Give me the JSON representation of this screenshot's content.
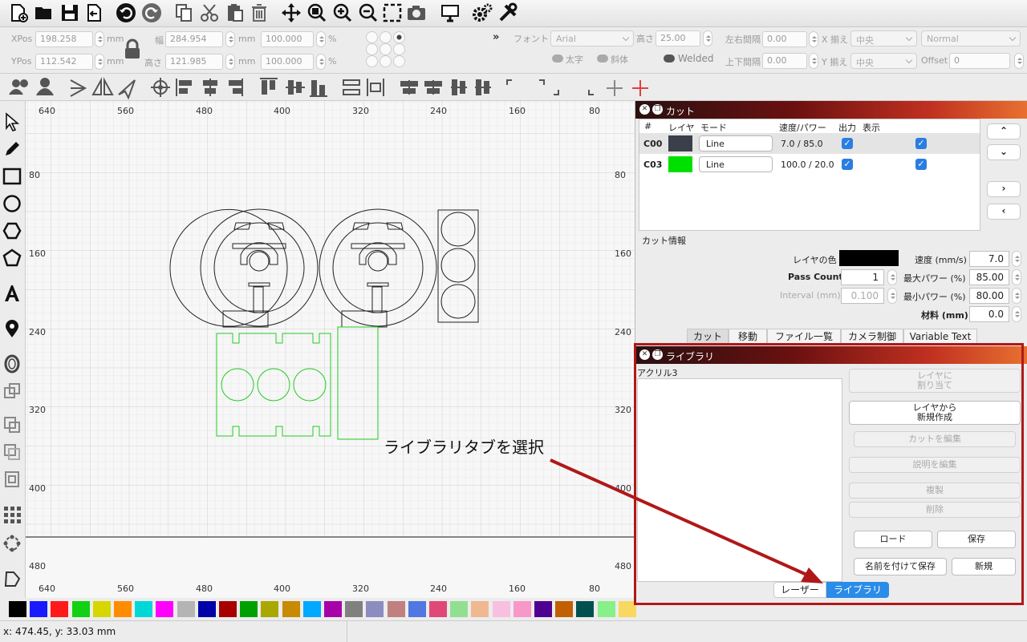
{
  "toolbar_icons": [
    "new-file-icon",
    "open-folder-icon",
    "save-icon",
    "export-icon",
    "undo-icon",
    "redo-icon",
    "copy-icon",
    "cut-icon",
    "paste-icon",
    "delete-icon",
    "move-icon",
    "zoom-fit-icon",
    "zoom-in-icon",
    "zoom-out-icon",
    "select-frame-icon",
    "camera-icon",
    "monitor-icon",
    "settings-icon",
    "tools-icon"
  ],
  "props": {
    "xpos_label": "XPos",
    "xpos": "198.258",
    "ypos_label": "YPos",
    "ypos": "112.542",
    "mm": "mm",
    "width_label": "幅",
    "width": "284.954",
    "height_label": "高さ",
    "height": "121.985",
    "scale_x": "100.000",
    "scale_y": "100.000",
    "percent": "%",
    "font_label": "フォント",
    "font": "Arial",
    "font_height_label": "高さ",
    "font_height": "25.00",
    "hspace_label": "左右間隔",
    "hspace": "0.00",
    "vspace_label": "上下間隔",
    "vspace": "0.00",
    "xalign_label": "X 揃え",
    "xalign": "中央",
    "yalign_label": "Y 揃え",
    "yalign": "中央",
    "mode": "Normal",
    "offset_label": "Offset",
    "offset": "0",
    "bold_label": "太字",
    "italic_label": "斜体",
    "welded_label": "Welded"
  },
  "ruler": {
    "top": [
      "640",
      "560",
      "480",
      "400",
      "320",
      "240",
      "160",
      "80"
    ],
    "left": [
      "80",
      "160",
      "240",
      "320",
      "400",
      "480"
    ]
  },
  "annotation": "ライブラリタブを選択",
  "palette": [
    "#000000",
    "#1a1aff",
    "#ff1a1a",
    "#12d012",
    "#d6d600",
    "#ff8c00",
    "#00d8d8",
    "#ff00ff",
    "#b4b4b4",
    "#0000a8",
    "#a80000",
    "#00a000",
    "#a8a800",
    "#c88a00",
    "#00a8ff",
    "#a800a8",
    "#808080",
    "#8c8cc0",
    "#c08080",
    "#5078e0",
    "#e04878",
    "#90e090",
    "#f0b890",
    "#f8c0e0",
    "#f898c8",
    "#500090",
    "#c06000",
    "#005050",
    "#88f088",
    "#f8d860"
  ],
  "status": {
    "coords": "x: 474.45, y: 33.03 mm"
  },
  "cut_panel": {
    "title": "カット",
    "headers": [
      "#",
      "レイヤ",
      "モード",
      "速度/パワー",
      "出力",
      "表示"
    ],
    "rows": [
      {
        "id": "C00",
        "color": "#3a3f4a",
        "mode": "Line",
        "speed_power": "7.0 / 85.0"
      },
      {
        "id": "C03",
        "color": "#00e000",
        "mode": "Line",
        "speed_power": "100.0 / 20.0"
      }
    ],
    "info_title": "カット情報",
    "layer_color_label": "レイヤの色",
    "pass_count_label": "Pass Count",
    "pass_count": "1",
    "interval_label": "Interval (mm)",
    "interval": "0.100",
    "speed_label": "速度 (mm/s)",
    "speed": "7.0",
    "max_power_label": "最大パワー (%)",
    "max_power": "85.00",
    "min_power_label": "最小パワー (%)",
    "min_power": "80.00",
    "material_label": "材料 (mm)",
    "material": "0.0",
    "tabs": [
      "カット",
      "移動",
      "ファイル一覧",
      "カメラ制御",
      "Variable Text"
    ]
  },
  "library_panel": {
    "title": "ライブラリ",
    "list_header": "アクリル3",
    "assign_btn": "レイヤに\n割り当て",
    "new_from_layer_btn": "レイヤから\n新規作成",
    "edit_cut_btn": "カットを編集",
    "edit_desc_btn": "説明を編集",
    "duplicate_btn": "複製",
    "delete_btn": "削除",
    "load_btn": "ロード",
    "save_btn": "保存",
    "save_as_btn": "名前を付けて保存",
    "new_btn": "新規",
    "tabs": [
      "レーザー",
      "ライブラリ"
    ]
  }
}
